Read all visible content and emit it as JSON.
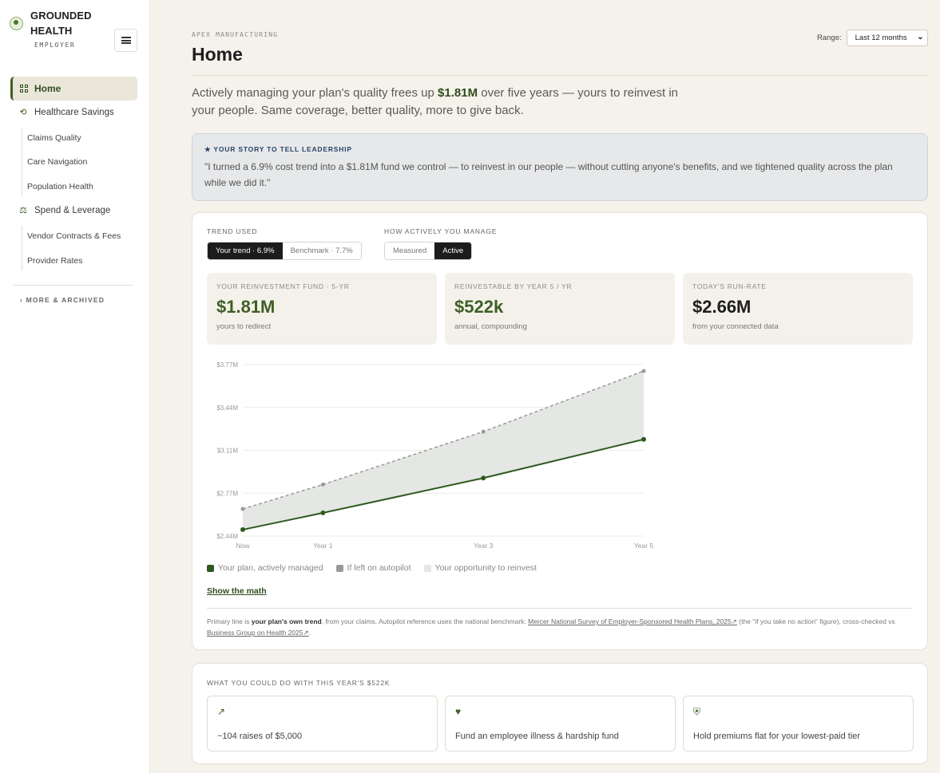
{
  "brand": {
    "name": "GROUNDED HEALTH",
    "sub": "EMPLOYER"
  },
  "sidebar": {
    "home": "Home",
    "savings": "Healthcare Savings",
    "savings_items": [
      "Claims Quality",
      "Care Navigation",
      "Population Health"
    ],
    "spend": "Spend & Leverage",
    "spend_items": [
      "Vendor Contracts & Fees",
      "Provider Rates"
    ],
    "more": "› MORE & ARCHIVED"
  },
  "header": {
    "eyebrow": "APEX MANUFACTURING",
    "title": "Home",
    "range_label": "Range:",
    "range_value": "Last 12 months"
  },
  "hero": {
    "pre": "Actively managing your plan's quality frees up ",
    "amount": "$1.81M",
    "post": " over five years — yours to reinvest in your people. Same coverage, better quality, more to give back."
  },
  "story": {
    "heading": "★ YOUR STORY TO TELL LEADERSHIP",
    "quote": "\"I turned a 6.9% cost trend into a $1.81M fund we control — to reinvest in our people — without cutting anyone's benefits, and we tightened quality across the plan while we did it.\""
  },
  "controls": {
    "trend_label": "TREND USED",
    "trend_options": [
      "Your trend · 6.9%",
      "Benchmark · 7.7%"
    ],
    "manage_label": "HOW ACTIVELY YOU MANAGE",
    "manage_options": [
      "Measured",
      "Active"
    ]
  },
  "kpis": [
    {
      "label": "YOUR REINVESTMENT FUND · 5-YR",
      "value": "$1.81M",
      "sub": "yours to redirect"
    },
    {
      "label": "REINVESTABLE BY YEAR 5 / YR",
      "value": "$522k",
      "sub": "annual, compounding"
    },
    {
      "label": "TODAY'S RUN-RATE",
      "value": "$2.66M",
      "sub": "from your connected data"
    }
  ],
  "chart_data": {
    "type": "line",
    "categories": [
      "Now",
      "Year 1",
      "Year 3",
      "Year 5"
    ],
    "series": [
      {
        "name": "Your plan, actively managed",
        "values": [
          2.49,
          2.62,
          2.89,
          3.19
        ],
        "color": "#2f5a1f"
      },
      {
        "name": "If left on autopilot",
        "values": [
          2.65,
          2.84,
          3.25,
          3.72
        ],
        "color": "#9a9a9a"
      }
    ],
    "area_label": "Your opportunity to reinvest",
    "area_color": "#e4e7e3",
    "y_ticks": [
      "$2.44M",
      "$2.77M",
      "$3.11M",
      "$3.44M",
      "$3.77M"
    ],
    "ylim": [
      2.44,
      3.77
    ],
    "grid": true
  },
  "legend": [
    "Your plan, actively managed",
    "If left on autopilot",
    "Your opportunity to reinvest"
  ],
  "show_math": "Show the math",
  "footnote": {
    "p1": "Primary line is ",
    "b1": "your plan's own trend",
    "p2": ", from your claims. Autopilot reference uses the national benchmark: ",
    "link1": "Mercer National Survey of Employer-Sponsored Health Plans, 2025↗",
    "p3": " (the \"if you take no action\" figure), cross-checked vs ",
    "link2": "Business Group on Health 2025↗",
    "p4": "."
  },
  "ideas": {
    "heading": "WHAT YOU COULD DO WITH THIS YEAR'S $522K",
    "items": [
      {
        "icon": "↗",
        "text": "~104 raises of $5,000"
      },
      {
        "icon": "♥",
        "text": "Fund an employee illness & hardship fund"
      },
      {
        "icon": "⛨",
        "text": "Hold premiums flat for your lowest-paid tier"
      }
    ]
  }
}
